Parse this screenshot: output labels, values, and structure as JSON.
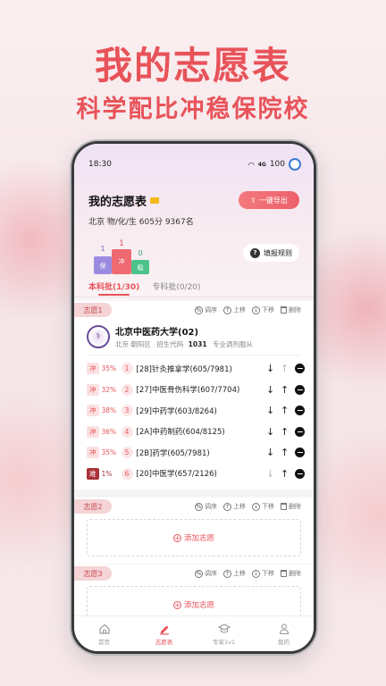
{
  "promo": {
    "headline": "我的志愿表",
    "subline": "科学配比冲稳保院校"
  },
  "status_bar": {
    "time": "18:30",
    "signal": "4G",
    "battery": "100"
  },
  "header": {
    "title": "我的志愿表",
    "export_label": "一键导出",
    "info": "北京 物/化/生 605分 9367名",
    "rules_label": "填报规则",
    "podium_labels": [
      "1",
      "1",
      "0"
    ],
    "podium_words": [
      "保",
      "冲",
      "稳"
    ]
  },
  "tabs": [
    {
      "label": "本科批(1/30)",
      "active": true
    },
    {
      "label": "专科批(0/20)",
      "active": false
    }
  ],
  "ops": {
    "adjust": "调序",
    "up": "上移",
    "down": "下移",
    "delete": "删除"
  },
  "choices": [
    {
      "tag": "志愿1",
      "school": {
        "name": "北京中医药大学(02)",
        "location": "北京·朝阳区",
        "code_label": "招生代码",
        "code": "1031",
        "policy": "专业调剂服从"
      },
      "majors": [
        {
          "type": "冲",
          "pct": "35%",
          "idx": "1",
          "name": "[28]针灸推拿学(605/7981)"
        },
        {
          "type": "冲",
          "pct": "32%",
          "idx": "2",
          "name": "[27]中医骨伤科学(607/7704)"
        },
        {
          "type": "冲",
          "pct": "38%",
          "idx": "3",
          "name": "[29]中药学(603/8264)"
        },
        {
          "type": "冲",
          "pct": "36%",
          "idx": "4",
          "name": "[2A]中药制药(604/8125)"
        },
        {
          "type": "冲",
          "pct": "35%",
          "idx": "5",
          "name": "[2B]药学(605/7981)"
        },
        {
          "type": "难",
          "pct": "1%",
          "idx": "6",
          "name": "[20]中医学(657/2126)"
        }
      ]
    },
    {
      "tag": "志愿2",
      "add_label": "添加志愿"
    },
    {
      "tag": "志愿3",
      "add_label": "添加志愿"
    }
  ],
  "bottom_nav": [
    {
      "label": "首页",
      "icon": "home-icon",
      "active": false
    },
    {
      "label": "志愿表",
      "icon": "edit-icon",
      "active": true
    },
    {
      "label": "专家1v1",
      "icon": "graduation-cap-icon",
      "active": false
    },
    {
      "label": "我的",
      "icon": "user-icon",
      "active": false
    }
  ],
  "colors": {
    "accent": "#e8535a",
    "dark_red": "#a9313a"
  }
}
